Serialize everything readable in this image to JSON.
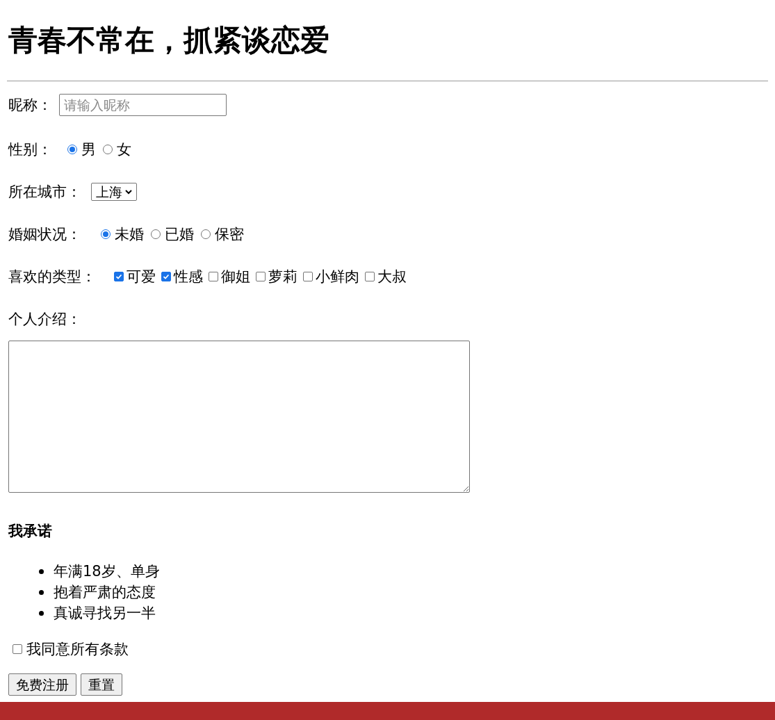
{
  "title": "青春不常在，抓紧谈恋爱",
  "nickname": {
    "label": "昵称：",
    "placeholder": "请输入昵称"
  },
  "gender": {
    "label": "性别：",
    "options": [
      {
        "label": "男",
        "selected": true
      },
      {
        "label": "女",
        "selected": false
      }
    ]
  },
  "city": {
    "label": "所在城市：",
    "value": "上海"
  },
  "marital": {
    "label": "婚姻状况：",
    "options": [
      {
        "label": "未婚",
        "selected": true
      },
      {
        "label": "已婚",
        "selected": false
      },
      {
        "label": "保密",
        "selected": false
      }
    ]
  },
  "types": {
    "label": "喜欢的类型：",
    "options": [
      {
        "label": "可爱",
        "checked": true
      },
      {
        "label": "性感",
        "checked": true
      },
      {
        "label": "御姐",
        "checked": false
      },
      {
        "label": "萝莉",
        "checked": false
      },
      {
        "label": "小鲜肉",
        "checked": false
      },
      {
        "label": "大叔",
        "checked": false
      }
    ]
  },
  "intro": {
    "label": "个人介绍："
  },
  "promise": {
    "heading": "我承诺",
    "items": [
      "年满18岁、单身",
      "抱着严肃的态度",
      "真诚寻找另一半"
    ]
  },
  "agree": {
    "label": "我同意所有条款",
    "checked": false
  },
  "buttons": [
    "免费注册",
    "重置"
  ]
}
